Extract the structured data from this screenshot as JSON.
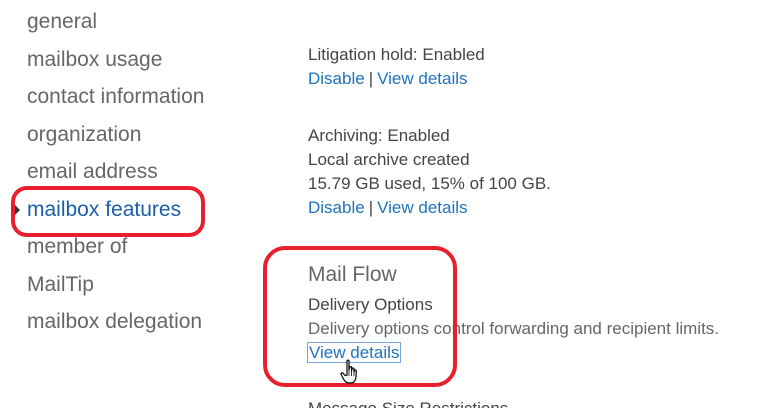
{
  "nav": {
    "items": [
      {
        "label": "general"
      },
      {
        "label": "mailbox usage"
      },
      {
        "label": "contact information"
      },
      {
        "label": "organization"
      },
      {
        "label": "email address"
      },
      {
        "label": "mailbox features"
      },
      {
        "label": "member of"
      },
      {
        "label": "MailTip"
      },
      {
        "label": "mailbox delegation"
      }
    ],
    "active_index": 5
  },
  "litigation": {
    "status": "Litigation hold: Enabled",
    "disable_label": "Disable",
    "separator": "|",
    "view_label": "View details"
  },
  "archiving": {
    "status": "Archiving: Enabled",
    "local": "Local archive created",
    "usage": "15.79 GB used, 15% of 100 GB.",
    "disable_label": "Disable",
    "separator": "|",
    "view_label": "View details"
  },
  "mail_flow": {
    "title": "Mail Flow",
    "delivery_title": "Delivery Options",
    "delivery_desc": "Delivery options control forwarding and recipient limits.",
    "view_label": "View details",
    "next_partial": "Message Size Restrictions"
  },
  "colors": {
    "accent": "#1e73be",
    "annotation": "#e8202e",
    "active_nav": "#1b5fa8"
  }
}
